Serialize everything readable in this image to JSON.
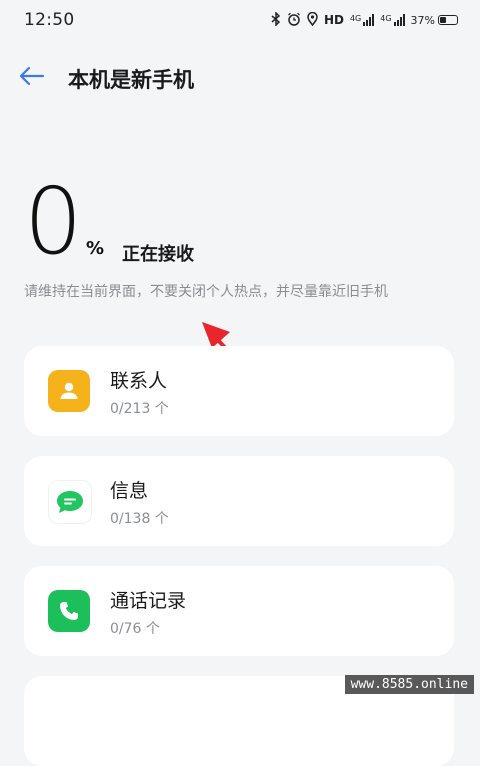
{
  "status_bar": {
    "time": "12:50",
    "hd_label": "HD",
    "network_1": "4G",
    "network_2": "4G",
    "battery_percent": "37%",
    "battery_level": 0.37,
    "icons": [
      "bluetooth-icon",
      "alarm-icon",
      "location-icon",
      "hd-icon",
      "signal-icon",
      "battery-icon"
    ]
  },
  "header": {
    "back_icon": "back-arrow-icon",
    "title": "本机是新手机"
  },
  "progress": {
    "value": "0",
    "unit": "%",
    "status": "正在接收",
    "hint": "请维持在当前界面，不要关闭个人热点，并尽量靠近旧手机"
  },
  "items": [
    {
      "title": "联系人",
      "count": "0/213 个",
      "icon": "contacts-icon",
      "color": "#f5b21a"
    },
    {
      "title": "信息",
      "count": "0/138 个",
      "icon": "message-icon",
      "color": "#22c55e"
    },
    {
      "title": "通话记录",
      "count": "0/76 个",
      "icon": "phone-icon",
      "color": "#1dbf5a"
    }
  ],
  "annotation": {
    "color": "#e8262b"
  },
  "watermark": "www.8585.online"
}
